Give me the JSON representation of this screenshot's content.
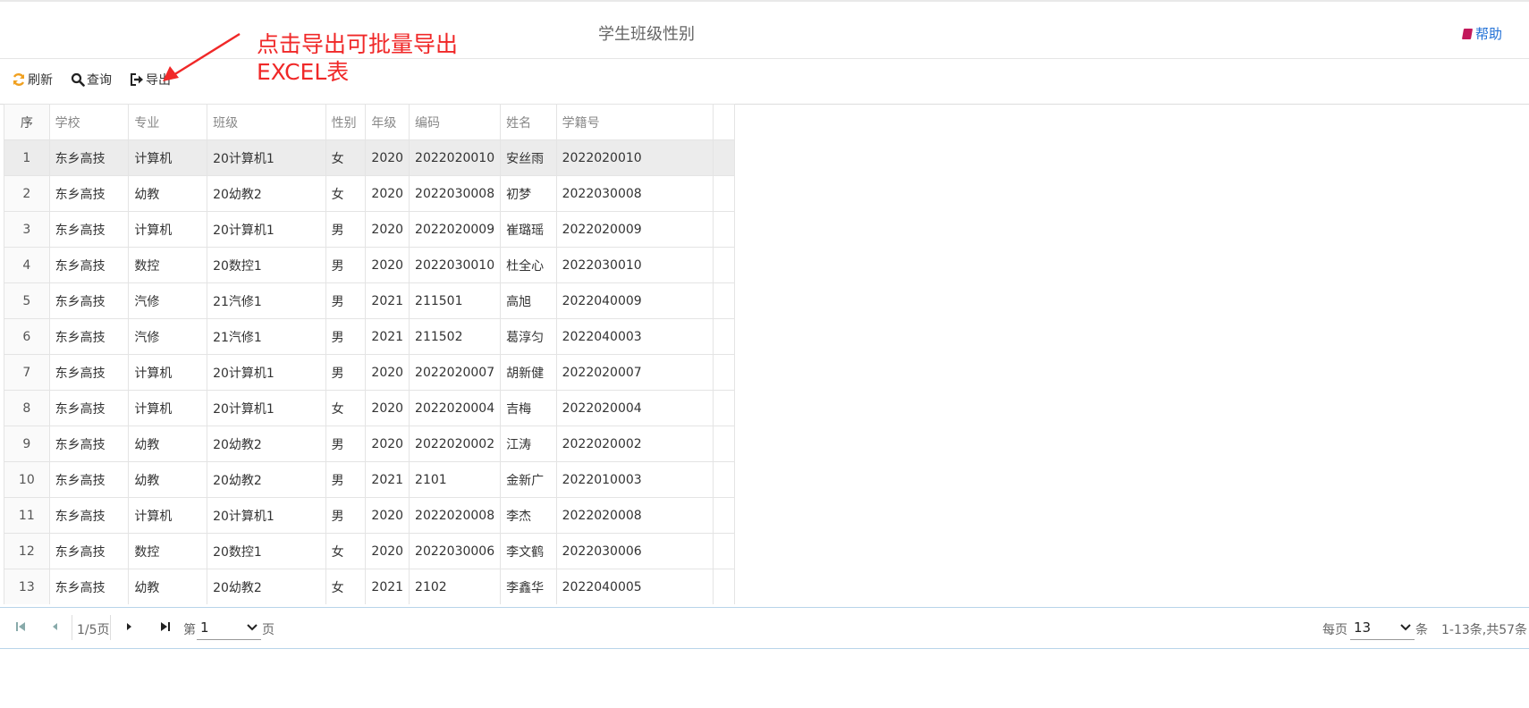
{
  "header": {
    "title": "学生班级性别",
    "help_label": "帮助"
  },
  "toolbar": {
    "refresh_label": "刷新",
    "query_label": "查询",
    "export_label": "导出"
  },
  "annotation": {
    "line1": "点击导出可批量导出",
    "line2": "EXCEL表"
  },
  "table": {
    "columns": [
      "序",
      "学校",
      "专业",
      "班级",
      "性别",
      "年级",
      "编码",
      "姓名",
      "学籍号"
    ],
    "rows": [
      [
        "1",
        "东乡高技",
        "计算机",
        "20计算机1",
        "女",
        "2020",
        "2022020010",
        "安丝雨",
        "2022020010"
      ],
      [
        "2",
        "东乡高技",
        "幼教",
        "20幼教2",
        "女",
        "2020",
        "2022030008",
        "初梦",
        "2022030008"
      ],
      [
        "3",
        "东乡高技",
        "计算机",
        "20计算机1",
        "男",
        "2020",
        "2022020009",
        "崔璐瑶",
        "2022020009"
      ],
      [
        "4",
        "东乡高技",
        "数控",
        "20数控1",
        "男",
        "2020",
        "2022030010",
        "杜全心",
        "2022030010"
      ],
      [
        "5",
        "东乡高技",
        "汽修",
        "21汽修1",
        "男",
        "2021",
        "211501",
        "高旭",
        "2022040009"
      ],
      [
        "6",
        "东乡高技",
        "汽修",
        "21汽修1",
        "男",
        "2021",
        "211502",
        "葛淳匀",
        "2022040003"
      ],
      [
        "7",
        "东乡高技",
        "计算机",
        "20计算机1",
        "男",
        "2020",
        "2022020007",
        "胡新健",
        "2022020007"
      ],
      [
        "8",
        "东乡高技",
        "计算机",
        "20计算机1",
        "女",
        "2020",
        "2022020004",
        "吉梅",
        "2022020004"
      ],
      [
        "9",
        "东乡高技",
        "幼教",
        "20幼教2",
        "男",
        "2020",
        "2022020002",
        "江涛",
        "2022020002"
      ],
      [
        "10",
        "东乡高技",
        "幼教",
        "20幼教2",
        "男",
        "2021",
        "2101",
        "金新广",
        "2022010003"
      ],
      [
        "11",
        "东乡高技",
        "计算机",
        "20计算机1",
        "男",
        "2020",
        "2022020008",
        "李杰",
        "2022020008"
      ],
      [
        "12",
        "东乡高技",
        "数控",
        "20数控1",
        "女",
        "2020",
        "2022030006",
        "李文鹤",
        "2022030006"
      ],
      [
        "13",
        "东乡高技",
        "幼教",
        "20幼教2",
        "女",
        "2021",
        "2102",
        "李鑫华",
        "2022040005"
      ]
    ]
  },
  "pager": {
    "page_info": "1/5页",
    "goto_prefix": "第",
    "current_page": "1",
    "goto_suffix": "页",
    "per_page_prefix": "每页",
    "per_page": "13",
    "per_page_suffix": "条",
    "summary": "1-13条,共57条"
  },
  "colors": {
    "annotation": "#f02828",
    "help_link": "#1f6fd6",
    "refresh_icon": "#f0a020"
  }
}
